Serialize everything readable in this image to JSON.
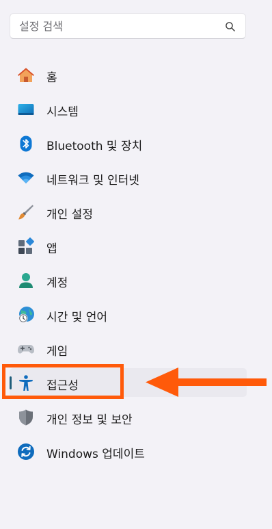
{
  "search": {
    "placeholder": "설정 검색",
    "value": ""
  },
  "nav": {
    "items": [
      {
        "label": "홈",
        "icon": "home-icon"
      },
      {
        "label": "시스템",
        "icon": "system-icon"
      },
      {
        "label": "Bluetooth 및 장치",
        "icon": "bluetooth-icon"
      },
      {
        "label": "네트워크 및 인터넷",
        "icon": "wifi-icon"
      },
      {
        "label": "개인 설정",
        "icon": "brush-icon"
      },
      {
        "label": "앱",
        "icon": "apps-icon"
      },
      {
        "label": "계정",
        "icon": "account-icon"
      },
      {
        "label": "시간 및 언어",
        "icon": "globe-clock-icon"
      },
      {
        "label": "게임",
        "icon": "gamepad-icon"
      },
      {
        "label": "접근성",
        "icon": "accessibility-icon",
        "selected": true
      },
      {
        "label": "개인 정보 및 보안",
        "icon": "shield-icon"
      },
      {
        "label": "Windows 업데이트",
        "icon": "update-icon"
      }
    ]
  },
  "annotation": {
    "highlight_color": "#ff5a0a",
    "target": "accessibility"
  },
  "colors": {
    "background": "#f3f2f7",
    "selected_background": "#eae9ef",
    "accent": "#1f5d7a"
  }
}
